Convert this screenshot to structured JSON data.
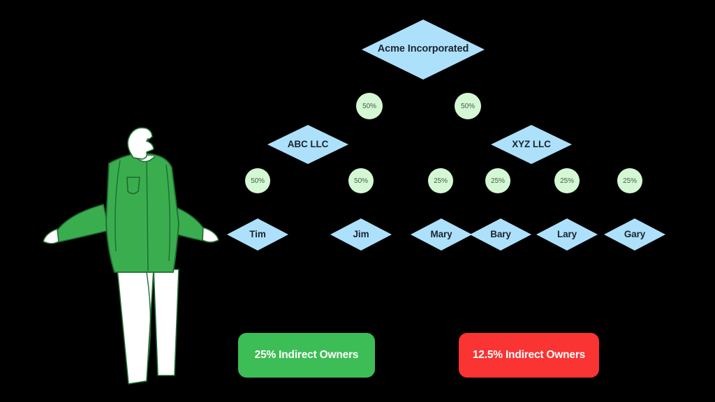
{
  "background_color": "#000000",
  "diagram": {
    "type": "ownership-hierarchy",
    "root": {
      "label": "Acme Incorporated"
    },
    "tier1_badges": [
      {
        "value": "50%"
      },
      {
        "value": "50%"
      }
    ],
    "entities": [
      {
        "label": "ABC LLC"
      },
      {
        "label": "XYZ LLC"
      }
    ],
    "tier2_badges": [
      {
        "value": "50%"
      },
      {
        "value": "50%"
      },
      {
        "value": "25%"
      },
      {
        "value": "25%"
      },
      {
        "value": "25%"
      },
      {
        "value": "25%"
      }
    ],
    "people": [
      {
        "label": "Tim"
      },
      {
        "label": "Jim"
      },
      {
        "label": "Mary"
      },
      {
        "label": "Bary"
      },
      {
        "label": "Lary"
      },
      {
        "label": "Gary"
      }
    ],
    "colors": {
      "node_fill": "#ade1fb",
      "node_text": "#1c2430",
      "badge_fill": "#d3f8d3",
      "badge_text": "#4a5c4a"
    }
  },
  "legend": {
    "items": [
      {
        "label": "25% Indirect Owners",
        "color": "#3dbd55"
      },
      {
        "label": "12.5% Indirect Owners",
        "color": "#fa3333"
      }
    ]
  },
  "illustration": {
    "name": "shrugging-person-illustration",
    "jacket_color": "#3aae4f",
    "outline_color": "#1f6b31",
    "skin_color": "#ffffff",
    "pants_color": "#ffffff"
  }
}
